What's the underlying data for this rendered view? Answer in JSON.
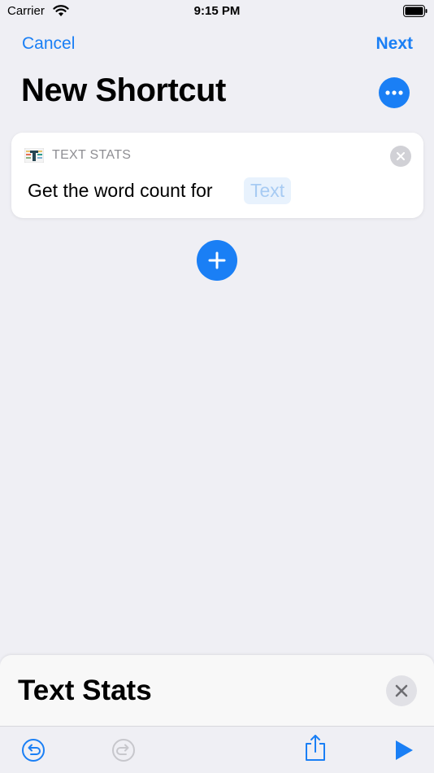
{
  "status_bar": {
    "carrier": "Carrier",
    "time": "9:15 PM",
    "icons": [
      "wifi-icon",
      "battery-icon"
    ]
  },
  "nav": {
    "cancel_label": "Cancel",
    "next_label": "Next",
    "more_icon": "ellipsis-icon"
  },
  "page": {
    "title": "New Shortcut"
  },
  "action": {
    "app_icon": "text-stats-app-icon",
    "app_name": "TEXT STATS",
    "sentence": "Get the word count for",
    "parameter_placeholder": "Text",
    "remove_icon": "close-icon"
  },
  "add_button_icon": "plus-icon",
  "bottom_sheet": {
    "title": "Text Stats",
    "close_icon": "close-icon"
  },
  "toolbar": {
    "icons": [
      "undo-icon",
      "redo-icon",
      "share-icon",
      "play-icon"
    ]
  },
  "colors": {
    "accent": "#1a7ff5",
    "background": "#efeff4",
    "card": "#ffffff",
    "secondary_text": "#8e8e93",
    "disabled": "#c7c7cc"
  }
}
